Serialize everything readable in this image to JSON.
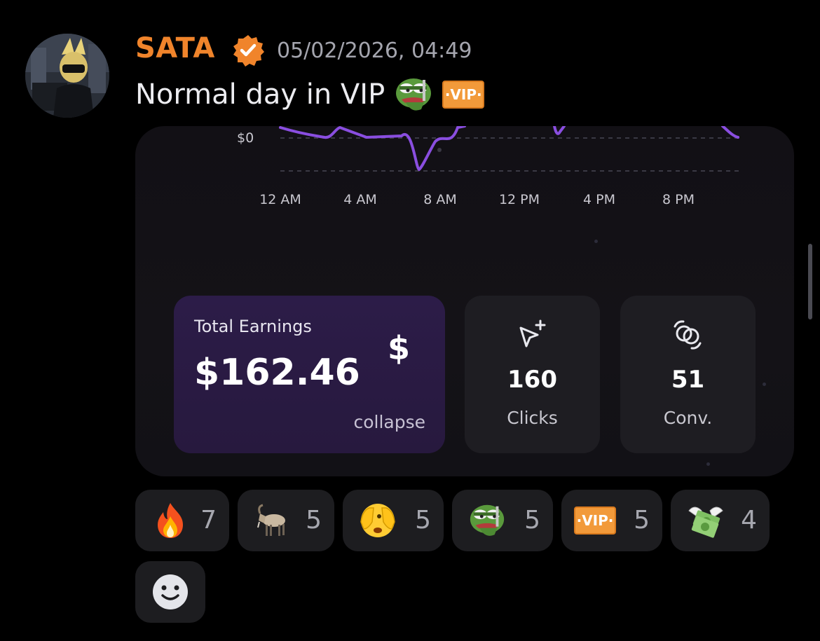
{
  "message": {
    "author": "SATA",
    "timestamp": "05/02/2026, 04:49",
    "text": "Normal day in VIP",
    "author_color": "#f0842b",
    "inline_emojis": [
      "pepe-emoji",
      "vip-emoji"
    ]
  },
  "embed": {
    "chart": {
      "y_tick": "$0",
      "x_ticks": [
        "12 AM",
        "4 AM",
        "8 AM",
        "12 PM",
        "4 PM",
        "8 PM"
      ],
      "line_color": "#8a4ee0"
    },
    "stats": {
      "earnings_label": "Total Earnings",
      "earnings_value": "$162.46",
      "earnings_icon": "$",
      "collapse_label": "collapse",
      "clicks_value": "160",
      "clicks_label": "Clicks",
      "conv_value": "51",
      "conv_label": "Conv."
    }
  },
  "reactions": [
    {
      "emoji": "fire-emoji",
      "count": "7"
    },
    {
      "emoji": "goat-emoji",
      "count": "5"
    },
    {
      "emoji": "face-peeking-emoji",
      "count": "5"
    },
    {
      "emoji": "pepe-emoji",
      "count": "5"
    },
    {
      "emoji": "vip-emoji",
      "count": "5"
    },
    {
      "emoji": "money-with-wings-emoji",
      "count": "4"
    }
  ],
  "vip_badge_text": "·VIP·"
}
